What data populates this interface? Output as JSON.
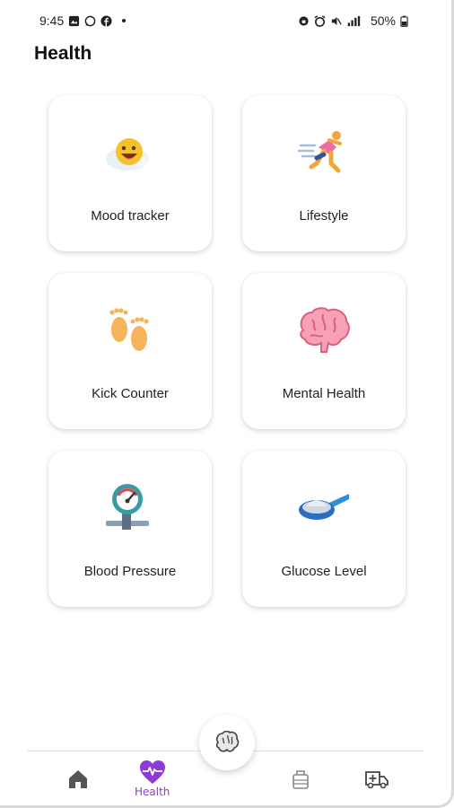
{
  "status_bar": {
    "time": "9:45",
    "battery": "50%",
    "left_icons": [
      "gallery-icon",
      "whatsapp-icon",
      "facebook-icon",
      "notification-dot-icon"
    ],
    "right_icons": [
      "lock-icon",
      "alarm-icon",
      "mute-icon",
      "signal-icon",
      "battery-icon"
    ]
  },
  "page": {
    "title": "Health"
  },
  "cards": [
    {
      "label": "Mood tracker",
      "icon": "mood-icon"
    },
    {
      "label": "Lifestyle",
      "icon": "running-person-icon"
    },
    {
      "label": "Kick Counter",
      "icon": "footprints-icon"
    },
    {
      "label": "Mental Health",
      "icon": "brain-icon"
    },
    {
      "label": "Blood Pressure",
      "icon": "pressure-gauge-icon"
    },
    {
      "label": "Glucose Level",
      "icon": "glucose-spoon-icon"
    }
  ],
  "bottom_nav": {
    "fab_icon": "brain-icon",
    "items": [
      {
        "icon": "home-icon",
        "label": ""
      },
      {
        "icon": "heart-pulse-icon",
        "label": "Health"
      },
      {
        "icon": "baby-bottle-icon",
        "label": ""
      },
      {
        "icon": "ambulance-icon",
        "label": ""
      }
    ],
    "accent": "#8e3bd6"
  }
}
